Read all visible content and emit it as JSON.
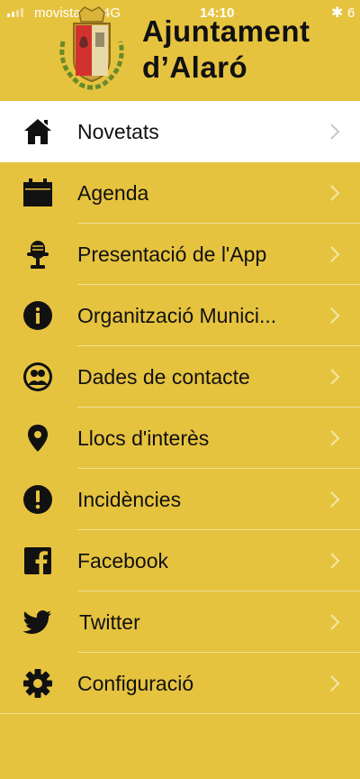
{
  "status_bar": {
    "carrier": "movistar",
    "network": "4G",
    "time": "14:10",
    "battery": "6"
  },
  "header": {
    "title_line1": "Ajuntament",
    "title_line2": "d’Alaró"
  },
  "colors": {
    "background": "#e6c33f",
    "active_row": "#ffffff",
    "text": "#111111"
  },
  "menu": {
    "items": [
      {
        "label": "Novetats",
        "icon": "home-icon",
        "active": true
      },
      {
        "label": "Agenda",
        "icon": "calendar-icon"
      },
      {
        "label": "Presentació de l'App",
        "icon": "microphone-icon"
      },
      {
        "label": "Organització Munici...",
        "icon": "info-icon"
      },
      {
        "label": "Dades de contacte",
        "icon": "contacts-icon"
      },
      {
        "label": "Llocs d'interès",
        "icon": "map-pin-icon"
      },
      {
        "label": "Incidències",
        "icon": "alert-icon"
      },
      {
        "label": "Facebook",
        "icon": "facebook-icon"
      },
      {
        "label": "Twitter",
        "icon": "twitter-icon"
      },
      {
        "label": "Configuració",
        "icon": "gear-icon"
      }
    ]
  }
}
